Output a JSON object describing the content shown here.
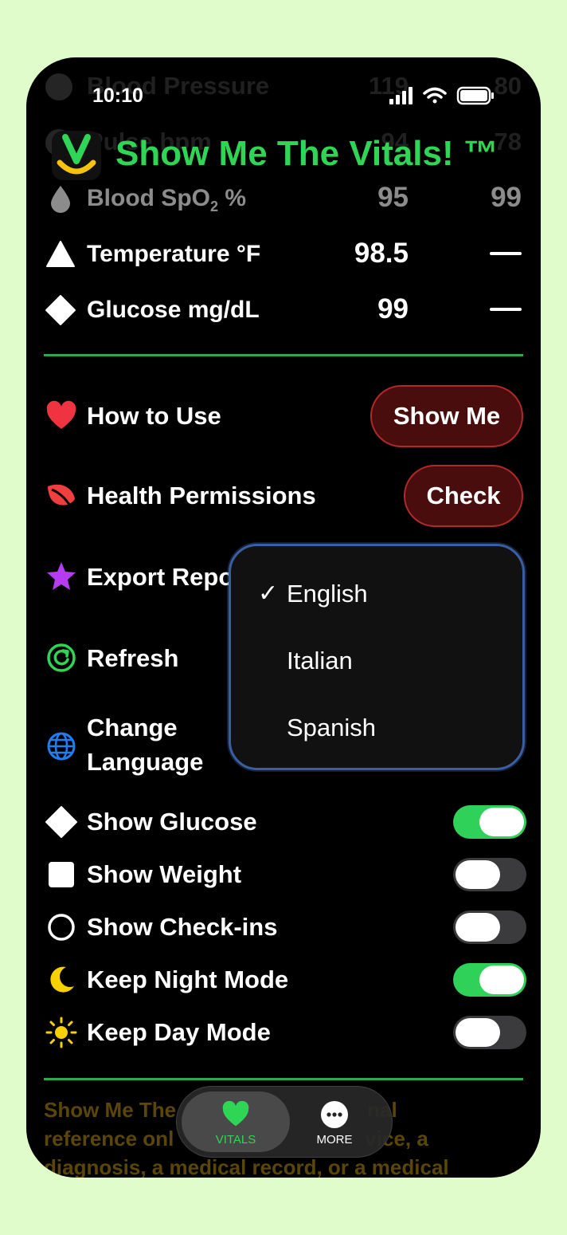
{
  "status_bar": {
    "time": "10:10"
  },
  "ghost_rows": [
    {
      "label": "Blood Pressure",
      "v1": "119",
      "v2": "80"
    },
    {
      "label": "Pulse bpm",
      "v1": "94",
      "v2": "78"
    }
  ],
  "app": {
    "title": "Show Me The Vitals! ™"
  },
  "vitals": [
    {
      "label_main": "Blood SpO",
      "label_sub": "2",
      "label_tail": " %",
      "v1": "95",
      "v2": "99",
      "icon": "drop-icon"
    },
    {
      "label": "Temperature °F",
      "v1": "98.5",
      "icon": "triangle-icon"
    },
    {
      "label": "Glucose mg/dL",
      "v1": "99",
      "icon": "diamond-icon"
    }
  ],
  "settings": {
    "how_to_use": {
      "label": "How to Use",
      "button": "Show Me"
    },
    "health_permissions": {
      "label": "Health Permissions",
      "button": "Check"
    },
    "export_report": {
      "label": "Export Repo"
    },
    "refresh": {
      "label": "Refresh"
    },
    "change_language": {
      "line1": "Change",
      "line2": "Language"
    }
  },
  "language_menu": {
    "check": "✓",
    "options": [
      "English",
      "Italian",
      "Spanish"
    ],
    "selected": "English"
  },
  "toggles": [
    {
      "label": "Show Glucose",
      "on": true
    },
    {
      "label": "Show Weight",
      "on": false
    },
    {
      "label": "Show Check-ins",
      "on": false
    },
    {
      "label": "Keep Night Mode",
      "on": true
    },
    {
      "label": "Keep Day Mode",
      "on": false
    }
  ],
  "disclaimer": {
    "line1": "Show Me The",
    "line1_tail": "nal",
    "line2": "reference onl",
    "line2_tail": "vice, a",
    "line3": "diagnosis, a medical record, or a medical"
  },
  "tabbar": {
    "vitals": "VITALS",
    "more": "MORE"
  },
  "colors": {
    "accent_green": "#2fd655",
    "button_red_bg": "#4a0d0d",
    "button_red_border": "#b12a2a",
    "page_bg": "#e1fccb"
  }
}
